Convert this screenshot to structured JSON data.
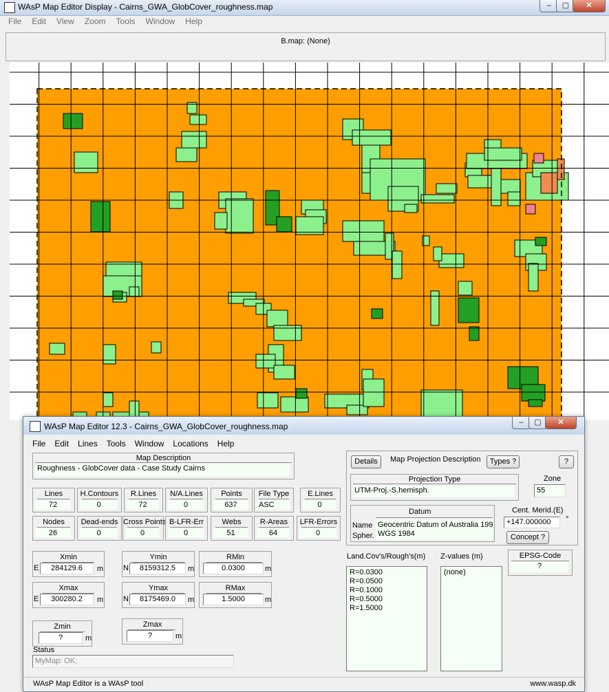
{
  "back_window": {
    "title": "WAsP Map Editor Display - Cairns_GWA_GlobCover_roughness.map",
    "controls": {
      "minimize": "‒",
      "maximize": "▢",
      "close": "✕"
    },
    "menu": [
      "File",
      "Edit",
      "View",
      "Zoom",
      "Tools",
      "Window",
      "Help"
    ],
    "bmap_label": "B.map: (None)",
    "map_colors": {
      "background": "#fe9e00",
      "light_green": "#8cf08c",
      "dark_green": "#23a023",
      "pink": "#f0828c",
      "salmon": "#f08c50",
      "grid": "#000000"
    }
  },
  "front_window": {
    "title": "WAsP Map Editor 12.3 - Cairns_GWA_GlobCover_roughness.map",
    "controls": {
      "minimize": "‒",
      "maximize": "▢",
      "close": "✕"
    },
    "menu": [
      "File",
      "Edit",
      "Lines",
      "Tools",
      "Window",
      "Locations",
      "Help"
    ],
    "map_description": {
      "label": "Map Description",
      "value": "Roughness - GlobCover data - Case Study Cairns"
    },
    "stats_row1": [
      {
        "label": "Lines",
        "value": "72"
      },
      {
        "label": "H.Contours",
        "value": "0"
      },
      {
        "label": "R.Lines",
        "value": "72"
      },
      {
        "label": "N/A.Lines",
        "value": "0"
      },
      {
        "label": "Points",
        "value": "637"
      },
      {
        "label": "File Type",
        "value": "ASC"
      },
      {
        "label": "E.Lines",
        "value": "0"
      }
    ],
    "stats_row2": [
      {
        "label": "Nodes",
        "value": "26"
      },
      {
        "label": "Dead-ends",
        "value": "0"
      },
      {
        "label": "Cross Points",
        "value": "0"
      },
      {
        "label": "B-LFR-Err",
        "value": "0"
      },
      {
        "label": "Webs",
        "value": "51"
      },
      {
        "label": "R-Areas",
        "value": "64"
      },
      {
        "label": "LFR-Errors",
        "value": "0"
      }
    ],
    "xmin": {
      "label": "Xmin",
      "prefix": "E",
      "value": "284129.6",
      "unit": "m"
    },
    "ymin": {
      "label": "Ymin",
      "prefix": "N",
      "value": "8159312.5",
      "unit": "m"
    },
    "rmin": {
      "label": "RMin",
      "value": "0.0300",
      "unit": "m"
    },
    "xmax": {
      "label": "Xmax",
      "prefix": "E",
      "value": "300280.2",
      "unit": "m"
    },
    "ymax": {
      "label": "Ymax",
      "prefix": "N",
      "value": "8175469.0",
      "unit": "m"
    },
    "rmax": {
      "label": "RMax",
      "value": "1.5000",
      "unit": "m"
    },
    "zmin": {
      "label": "Zmin",
      "value": "?",
      "unit": "m"
    },
    "zmax": {
      "label": "Zmax",
      "value": "?",
      "unit": "m"
    },
    "status": {
      "label": "Status",
      "value": "MyMap: OK;"
    },
    "projection": {
      "details_button": "Details",
      "description_label": "Map Projection Description",
      "types_button": "Types ?",
      "help_button": "?",
      "type_label": "Projection Type",
      "type_value": "UTM-Proj.-S.hemisph.",
      "zone_label": "Zone",
      "zone_value": "55",
      "datum_label": "Datum",
      "name_label": "Name",
      "spher_label": "Spher.",
      "datum_name": "Geocentric Datum of Australia 199",
      "spheroid": "WGS 1984",
      "cent_merid_label": "Cent. Merid.(E)",
      "cent_merid_value": "+147.000000",
      "degree_symbol": "°",
      "concept_button": "Concept ?"
    },
    "landcover": {
      "label": "Land.Cov's/Rough's(m)",
      "items": [
        "R=0.0300",
        "R=0.0500",
        "R=0.1000",
        "R=0.5000",
        "R=1.5000"
      ]
    },
    "zvalues": {
      "label": "Z-values (m)",
      "items": [
        "(none)"
      ]
    },
    "epsg": {
      "label": "EPSG-Code",
      "value": "?"
    },
    "footer_left": "WAsP Map Editor is a WAsP tool",
    "footer_right": "www.wasp.dk"
  }
}
